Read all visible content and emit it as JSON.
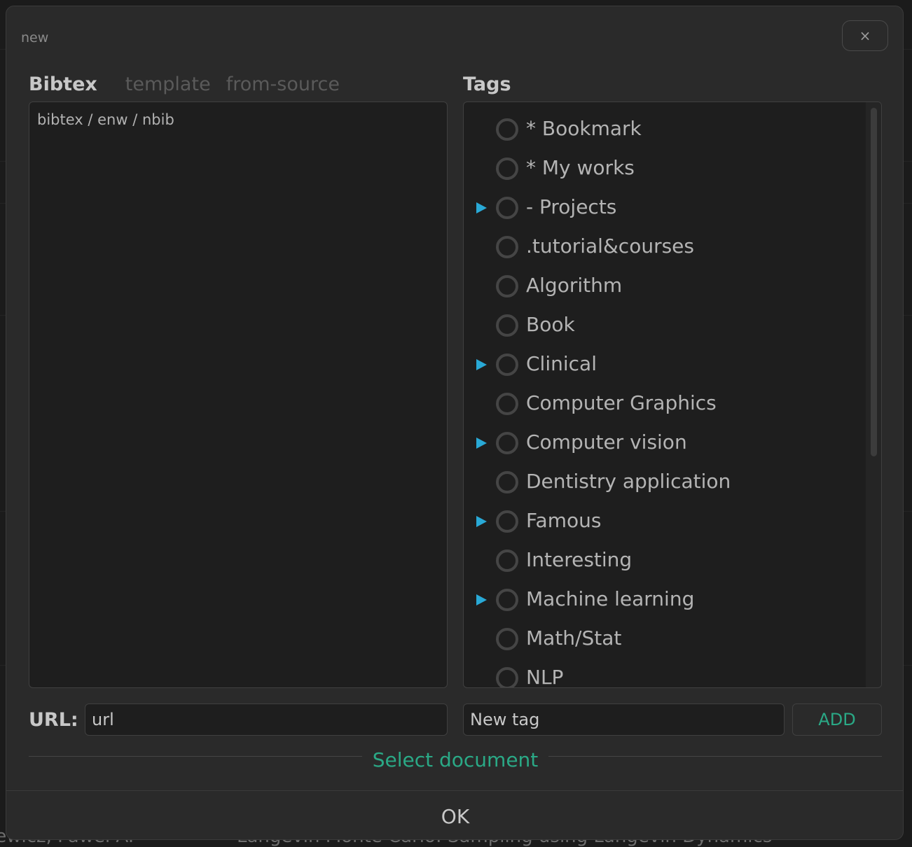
{
  "background": {
    "bottom_left_text": "iewicz, Paweł A.",
    "bottom_center_text": "Langevin Monte Carlo: Sampling using Langevin Dynamics"
  },
  "dialog": {
    "title": "new",
    "close_label": "×"
  },
  "source_tabs": [
    {
      "label": "Bibtex",
      "active": true
    },
    {
      "label": "template",
      "active": false
    },
    {
      "label": "from-source",
      "active": false
    }
  ],
  "bibtex": {
    "placeholder": "bibtex / enw / nbib",
    "value": ""
  },
  "tags": {
    "title": "Tags",
    "items": [
      {
        "label": "* Bookmark",
        "expandable": false
      },
      {
        "label": "* My works",
        "expandable": false
      },
      {
        "label": "- Projects",
        "expandable": true
      },
      {
        "label": ".tutorial&courses",
        "expandable": false
      },
      {
        "label": "Algorithm",
        "expandable": false
      },
      {
        "label": "Book",
        "expandable": false
      },
      {
        "label": "Clinical",
        "expandable": true
      },
      {
        "label": "Computer Graphics",
        "expandable": false
      },
      {
        "label": "Computer vision",
        "expandable": true
      },
      {
        "label": "Dentistry application",
        "expandable": false
      },
      {
        "label": "Famous",
        "expandable": true
      },
      {
        "label": "Interesting",
        "expandable": false
      },
      {
        "label": "Machine learning",
        "expandable": true
      },
      {
        "label": "Math/Stat",
        "expandable": false
      },
      {
        "label": "NLP",
        "expandable": false
      }
    ]
  },
  "url": {
    "label": "URL:",
    "value": "url"
  },
  "new_tag": {
    "value": "New tag",
    "add_label": "ADD"
  },
  "select_document_label": "Select document",
  "ok_label": "OK",
  "colors": {
    "accent": "#2aa986",
    "expand_arrow": "#29a9d6"
  }
}
